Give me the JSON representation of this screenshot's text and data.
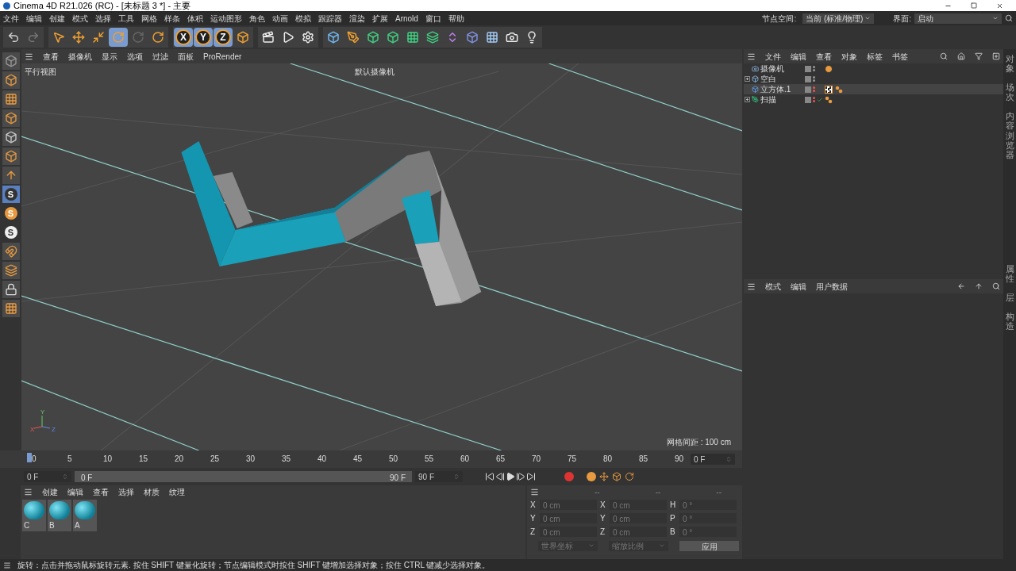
{
  "window": {
    "title": "Cinema 4D R21.026 (RC) - [未标题 3 *] - 主要"
  },
  "menu_bar": [
    "文件",
    "编辑",
    "创建",
    "模式",
    "选择",
    "工具",
    "网格",
    "样条",
    "体积",
    "运动图形",
    "角色",
    "动画",
    "模拟",
    "跟踪器",
    "渲染",
    "扩展",
    "Arnold",
    "窗口",
    "帮助"
  ],
  "node_space": {
    "label": "节点空间:",
    "value": "当前 (标准/物理)"
  },
  "layout_picker": {
    "label": "界面:",
    "value": "启动"
  },
  "toolbar": [
    [
      {
        "kind": "undo",
        "selected": false
      },
      {
        "kind": "redo",
        "selected": false
      }
    ],
    [
      {
        "kind": "cursor",
        "selected": false
      },
      {
        "kind": "move",
        "selected": false
      },
      {
        "kind": "scale",
        "selected": false
      },
      {
        "kind": "rotate",
        "selected": true
      },
      {
        "kind": "psr",
        "selected": false
      },
      {
        "kind": "rotate",
        "selected": false
      }
    ],
    [
      {
        "kind": "axis",
        "label": "X",
        "selected": true
      },
      {
        "kind": "axis",
        "label": "Y",
        "selected": true
      },
      {
        "kind": "axis",
        "label": "Z",
        "selected": true
      },
      {
        "kind": "coords",
        "selected": false
      }
    ],
    [
      {
        "kind": "render-view",
        "selected": false
      },
      {
        "kind": "render",
        "selected": false
      },
      {
        "kind": "render-settings",
        "selected": false
      }
    ],
    [
      {
        "kind": "cube",
        "selected": false
      },
      {
        "kind": "pen",
        "selected": false
      },
      {
        "kind": "subdivide",
        "selected": false
      },
      {
        "kind": "extrude",
        "selected": false
      },
      {
        "kind": "cloner",
        "selected": false
      },
      {
        "kind": "cubes",
        "selected": false
      },
      {
        "kind": "bend",
        "selected": false
      },
      {
        "kind": "capsule",
        "selected": false
      },
      {
        "kind": "floor",
        "selected": false
      },
      {
        "kind": "camera",
        "selected": false
      },
      {
        "kind": "light",
        "selected": false
      }
    ]
  ],
  "left_tools": [
    {
      "kind": "make-editable"
    },
    {
      "kind": "model"
    },
    {
      "kind": "texture"
    },
    {
      "kind": "points"
    },
    {
      "kind": "edges"
    },
    {
      "kind": "polygons"
    },
    {
      "kind": "axis-mode"
    },
    {
      "kind": "snap",
      "label": "S"
    },
    {
      "kind": "snap-orange",
      "label": "S"
    },
    {
      "kind": "snap-white",
      "label": "S"
    },
    {
      "kind": "magnet"
    },
    {
      "kind": "layers"
    },
    {
      "kind": "lock"
    },
    {
      "kind": "workplane"
    }
  ],
  "viewport": {
    "menu": [
      "查看",
      "摄像机",
      "显示",
      "选项",
      "过滤",
      "面板",
      "ProRender"
    ],
    "view_name": "平行视图",
    "camera": "默认摄像机",
    "grid_spacing": "网格间距 : 100 cm",
    "axes": [
      "Y",
      "X",
      "Z"
    ]
  },
  "object_manager": {
    "menu": [
      "文件",
      "编辑",
      "查看",
      "对象",
      "标签",
      "书签"
    ],
    "objects": [
      {
        "name": "摄像机",
        "kind": "camera",
        "collapsed": false,
        "selected": false,
        "hidden": false,
        "checked": false,
        "tags": [
          {
            "kind": "protection"
          }
        ]
      },
      {
        "name": "空白",
        "kind": "null",
        "collapsed": true,
        "selected": false,
        "hidden": false,
        "checked": false
      },
      {
        "name": "立方体.1",
        "kind": "cube",
        "collapsed": false,
        "selected": true,
        "hidden": true,
        "checked": false,
        "tags": [
          {
            "kind": "texture"
          },
          {
            "kind": "phong"
          }
        ]
      },
      {
        "name": "扫描",
        "kind": "sweep",
        "collapsed": true,
        "selected": false,
        "hidden": true,
        "checked": true,
        "tags": [
          {
            "kind": "phong"
          }
        ]
      }
    ]
  },
  "attributes": {
    "menu": [
      "模式",
      "编辑",
      "用户数据"
    ]
  },
  "side_tabs_top": [
    "对象",
    "场次",
    "内容浏览器"
  ],
  "side_tabs_bottom": [
    "属性",
    "层",
    "构造"
  ],
  "timeline": {
    "ticks": [
      "0",
      "5",
      "10",
      "15",
      "20",
      "25",
      "30",
      "35",
      "40",
      "45",
      "50",
      "55",
      "60",
      "65",
      "70",
      "75",
      "80",
      "85",
      "90"
    ],
    "current_frame": "0 F",
    "start": "0 F",
    "range_start": "0 F",
    "range_end": "90 F",
    "level": 1,
    "end": "90 F"
  },
  "materials": {
    "menu": [
      "创建",
      "编辑",
      "查看",
      "选择",
      "材质",
      "纹理"
    ],
    "items": [
      "C",
      "B",
      "A"
    ]
  },
  "coordinates": {
    "disabled": true,
    "headers": [
      "--",
      "--",
      "--"
    ],
    "rows": [
      [
        {
          "axis": "X",
          "value": "0 cm"
        },
        {
          "axis": "X",
          "value": "0 cm"
        },
        {
          "axis": "H",
          "value": "0 °"
        }
      ],
      [
        {
          "axis": "Y",
          "value": "0 cm"
        },
        {
          "axis": "Y",
          "value": "0 cm"
        },
        {
          "axis": "P",
          "value": "0 °"
        }
      ],
      [
        {
          "axis": "Z",
          "value": "0 cm"
        },
        {
          "axis": "Z",
          "value": "0 cm"
        },
        {
          "axis": "B",
          "value": "0 °"
        }
      ]
    ],
    "mode": "世界坐标",
    "scale": "缩放比例",
    "apply": "应用"
  },
  "status_bar": "旋转：点击并拖动鼠标旋转元素. 按住 SHIFT 键量化旋转；节点编辑模式时按住 SHIFT 键增加选择对象；按住 CTRL 键减少选择对象。"
}
